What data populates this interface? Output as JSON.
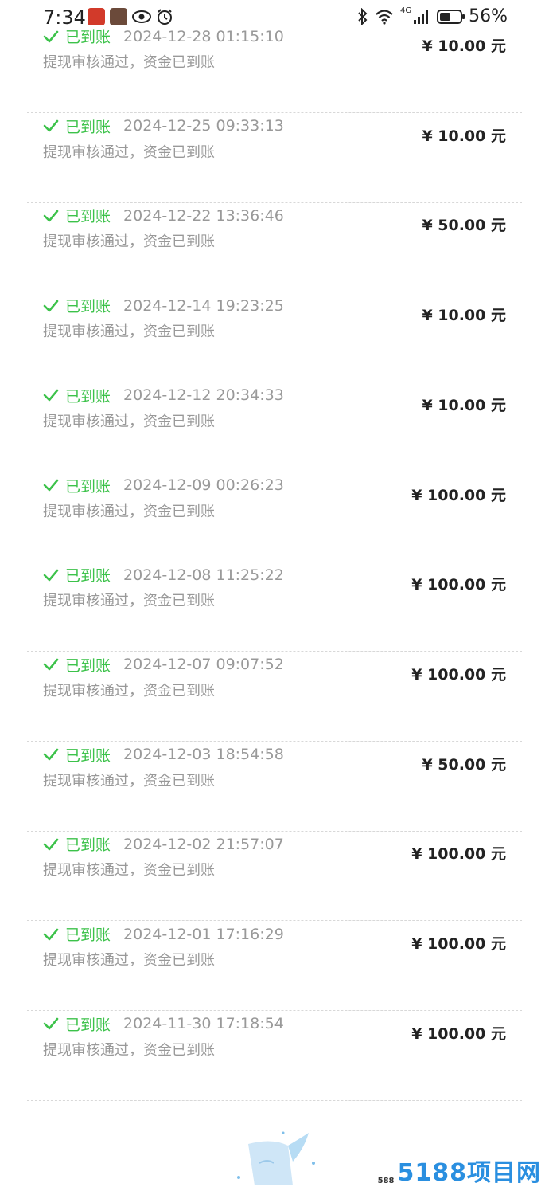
{
  "status_bar": {
    "time": "7:34",
    "network_label": "4G",
    "battery_percent": "56%",
    "battery_level": 0.56
  },
  "records": [
    {
      "status": "已到账",
      "datetime": "2024-12-28 01:15:10",
      "desc": "提现审核通过，资金已到账",
      "amount": "¥ 10.00 元"
    },
    {
      "status": "已到账",
      "datetime": "2024-12-25 09:33:13",
      "desc": "提现审核通过，资金已到账",
      "amount": "¥ 10.00 元"
    },
    {
      "status": "已到账",
      "datetime": "2024-12-22 13:36:46",
      "desc": "提现审核通过，资金已到账",
      "amount": "¥ 50.00 元"
    },
    {
      "status": "已到账",
      "datetime": "2024-12-14 19:23:25",
      "desc": "提现审核通过，资金已到账",
      "amount": "¥ 10.00 元"
    },
    {
      "status": "已到账",
      "datetime": "2024-12-12 20:34:33",
      "desc": "提现审核通过，资金已到账",
      "amount": "¥ 10.00 元"
    },
    {
      "status": "已到账",
      "datetime": "2024-12-09 00:26:23",
      "desc": "提现审核通过，资金已到账",
      "amount": "¥ 100.00 元"
    },
    {
      "status": "已到账",
      "datetime": "2024-12-08 11:25:22",
      "desc": "提现审核通过，资金已到账",
      "amount": "¥ 100.00 元"
    },
    {
      "status": "已到账",
      "datetime": "2024-12-07 09:07:52",
      "desc": "提现审核通过，资金已到账",
      "amount": "¥ 100.00 元"
    },
    {
      "status": "已到账",
      "datetime": "2024-12-03 18:54:58",
      "desc": "提现审核通过，资金已到账",
      "amount": "¥ 50.00 元"
    },
    {
      "status": "已到账",
      "datetime": "2024-12-02 21:57:07",
      "desc": "提现审核通过，资金已到账",
      "amount": "¥ 100.00 元"
    },
    {
      "status": "已到账",
      "datetime": "2024-12-01 17:16:29",
      "desc": "提现审核通过，资金已到账",
      "amount": "¥ 100.00 元"
    },
    {
      "status": "已到账",
      "datetime": "2024-11-30 17:18:54",
      "desc": "提现审核通过，资金已到账",
      "amount": "¥ 100.00 元"
    }
  ],
  "watermark": {
    "small": "588",
    "big": "5188项目网"
  },
  "colors": {
    "success_green": "#3cc24a",
    "muted_gray": "#999999",
    "amount_black": "#222222",
    "watermark_blue": "#2a8fe0"
  }
}
